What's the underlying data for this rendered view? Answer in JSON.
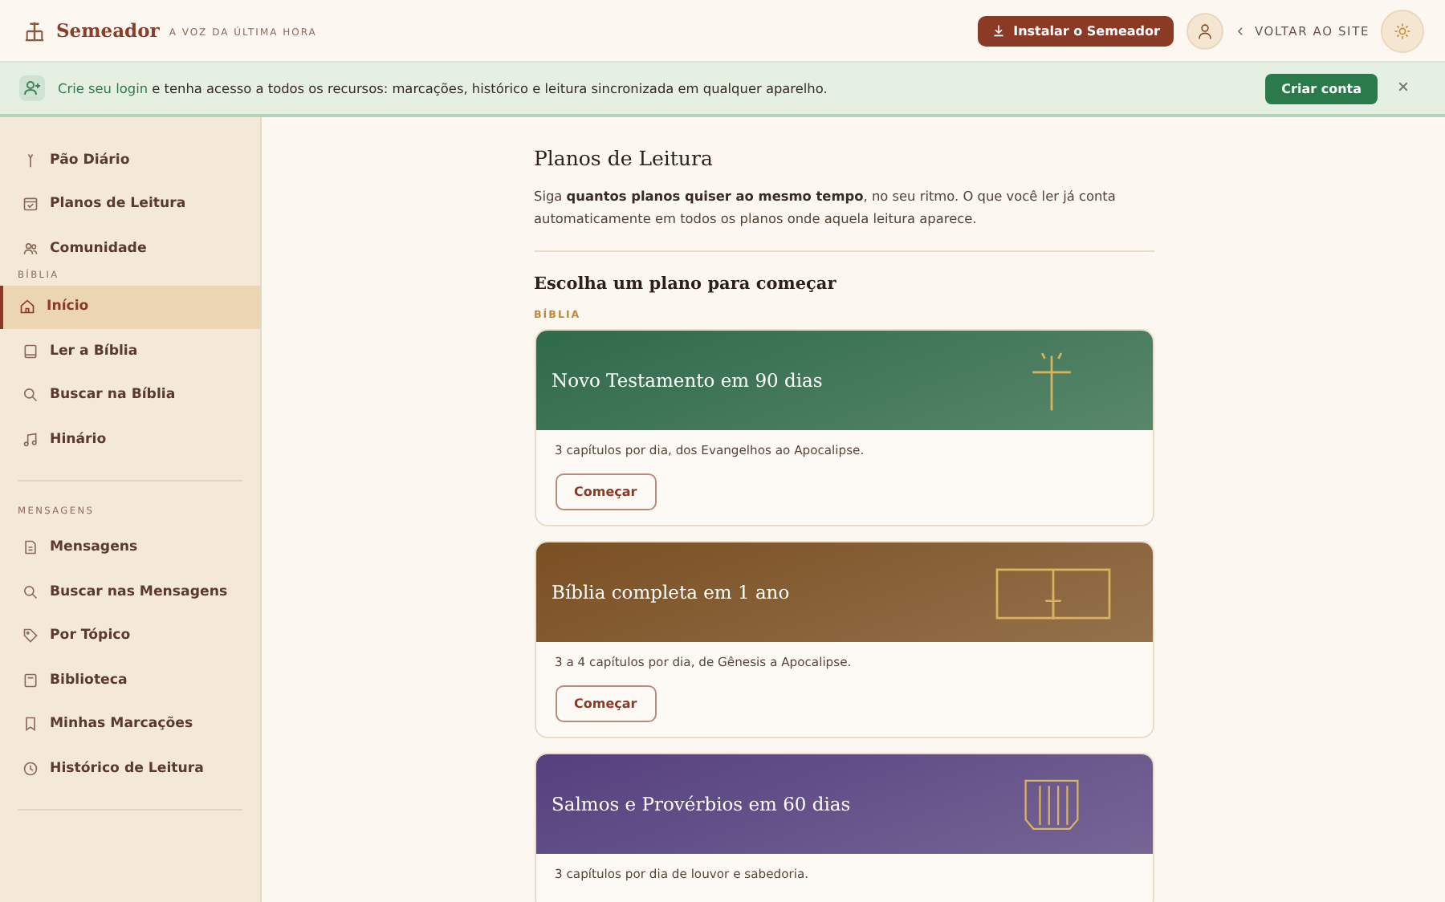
{
  "header": {
    "brand": "Semeador",
    "tagline": "A VOZ DA ÚLTIMA HORA",
    "install_button": "Instalar o Semeador",
    "back_link": "VOLTAR AO SITE"
  },
  "banner": {
    "text": "**Crie seu login** e tenha acesso a todos os recursos: marcações, histórico e leitura sincronizada em qualquer aparelho.",
    "button": "Criar conta"
  },
  "sidebar": {
    "sections": [
      {
        "items": [
          {
            "label": "Pão Diário",
            "selected": false
          },
          {
            "label": "Planos de Leitura",
            "selected": false
          },
          {
            "label": "Comunidade",
            "selected": false
          }
        ]
      },
      {
        "heading": "BÍBLIA",
        "items": [
          {
            "label": "Início",
            "selected": true
          },
          {
            "label": "Ler a Bíblia",
            "selected": false
          },
          {
            "label": "Buscar na Bíblia",
            "selected": false
          },
          {
            "label": "Hinário",
            "selected": false
          }
        ]
      },
      {
        "heading": "MENSAGENS",
        "items": [
          {
            "label": "Mensagens",
            "selected": false
          },
          {
            "label": "Buscar nas Mensagens",
            "selected": false
          },
          {
            "label": "Por Tópico",
            "selected": false
          },
          {
            "label": "Biblioteca",
            "selected": false
          },
          {
            "label": "Minhas Marcações",
            "selected": false
          },
          {
            "label": "Histórico de Leitura",
            "selected": false
          }
        ]
      }
    ]
  },
  "main": {
    "title": "Planos de Leitura",
    "intro": "Siga **quantos planos quiser ao mesmo tempo**, no seu ritmo. O que você ler já conta automaticamente em todos os planos onde aquela leitura aparece.",
    "subtitle": "Escolha um plano para começar",
    "category": "BÍBLIA",
    "plans": [
      {
        "title": "Novo Testamento em 90 dias",
        "description": "3 capítulos por dia, dos Evangelhos ao Apocalipse.",
        "button": "Começar",
        "color": "#2f6a4a"
      },
      {
        "title": "Bíblia completa em 1 ano",
        "description": "3 a 4 capítulos por dia, de Gênesis a Apocalipse.",
        "button": "Começar",
        "color": "#7a4f22"
      },
      {
        "title": "Salmos e Provérbios em 60 dias",
        "description": "3 capítulos por dia de louvor e sabedoria.",
        "color": "#55407e"
      }
    ]
  }
}
